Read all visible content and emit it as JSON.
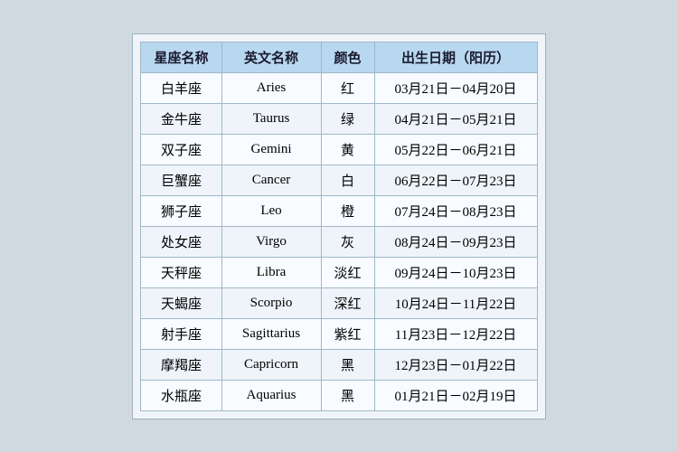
{
  "header": {
    "col1": "星座名称",
    "col2": "英文名称",
    "col3": "颜色",
    "col4": "出生日期（阳历）"
  },
  "rows": [
    {
      "chinese": "白羊座",
      "english": "Aries",
      "color": "红",
      "date": "03月21日－04月20日"
    },
    {
      "chinese": "金牛座",
      "english": "Taurus",
      "color": "绿",
      "date": "04月21日－05月21日"
    },
    {
      "chinese": "双子座",
      "english": "Gemini",
      "color": "黄",
      "date": "05月22日－06月21日"
    },
    {
      "chinese": "巨蟹座",
      "english": "Cancer",
      "color": "白",
      "date": "06月22日－07月23日"
    },
    {
      "chinese": "狮子座",
      "english": "Leo",
      "color": "橙",
      "date": "07月24日－08月23日"
    },
    {
      "chinese": "处女座",
      "english": "Virgo",
      "color": "灰",
      "date": "08月24日－09月23日"
    },
    {
      "chinese": "天秤座",
      "english": "Libra",
      "color": "淡红",
      "date": "09月24日－10月23日"
    },
    {
      "chinese": "天蝎座",
      "english": "Scorpio",
      "color": "深红",
      "date": "10月24日－11月22日"
    },
    {
      "chinese": "射手座",
      "english": "Sagittarius",
      "color": "紫红",
      "date": "11月23日－12月22日"
    },
    {
      "chinese": "摩羯座",
      "english": "Capricorn",
      "color": "黑",
      "date": "12月23日－01月22日"
    },
    {
      "chinese": "水瓶座",
      "english": "Aquarius",
      "color": "黑",
      "date": "01月21日－02月19日"
    }
  ]
}
